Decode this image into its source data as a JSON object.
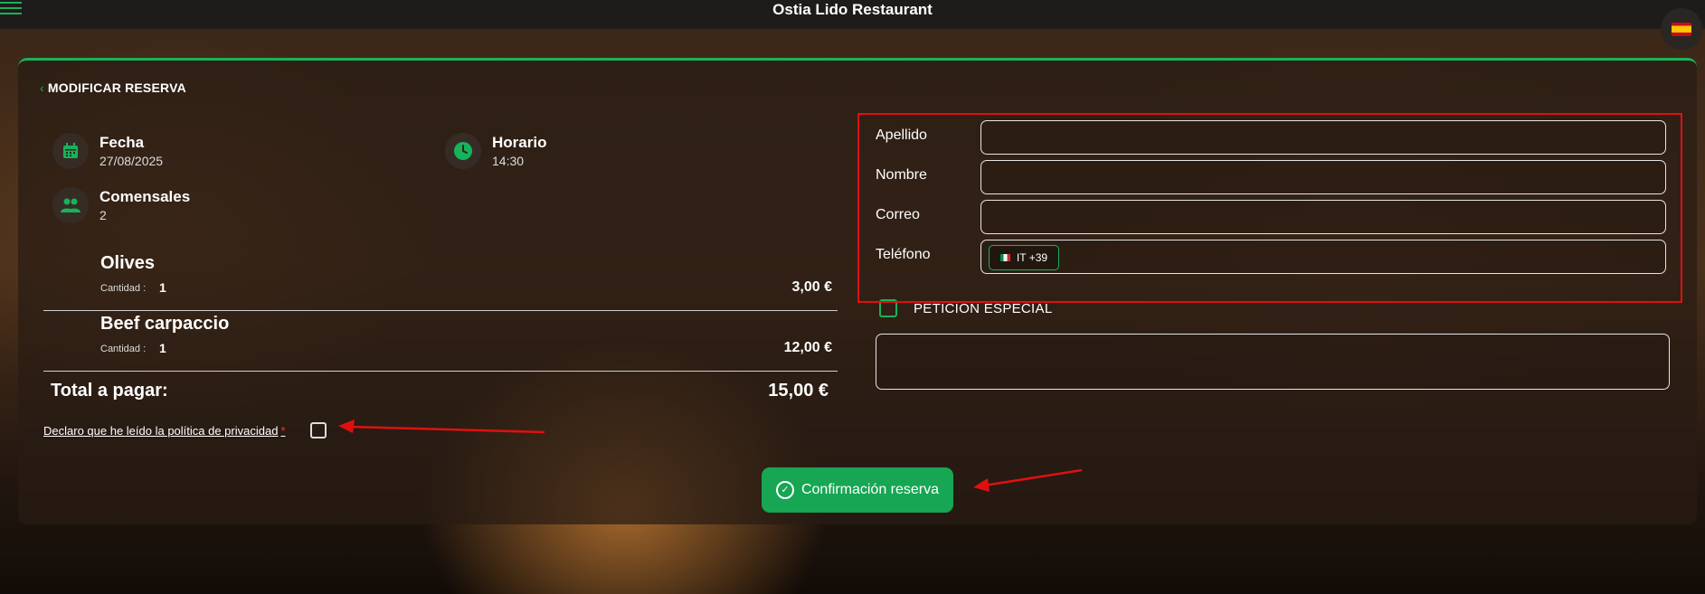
{
  "header": {
    "title": "Ostia Lido Restaurant",
    "menu_icon": "hamburger-menu-icon",
    "language_icon": "spain-flag-icon"
  },
  "card": {
    "back_label": "MODIFICAR RESERVA",
    "info": {
      "date": {
        "label": "Fecha",
        "value": "27/08/2025",
        "icon": "calendar-icon"
      },
      "time": {
        "label": "Horario",
        "value": "14:30",
        "icon": "clock-icon"
      },
      "guests": {
        "label": "Comensales",
        "value": "2",
        "icon": "people-icon"
      }
    },
    "items": [
      {
        "name": "Olives",
        "qty_label": "Cantidad :",
        "qty": "1",
        "price": "3,00 €"
      },
      {
        "name": "Beef carpaccio",
        "qty_label": "Cantidad :",
        "qty": "1",
        "price": "12,00 €"
      }
    ],
    "total": {
      "label": "Total a pagar:",
      "amount": "15,00 €"
    },
    "privacy": {
      "label": "Declaro que he leído la política de privacidad",
      "required_mark": "*"
    },
    "form": {
      "fields": [
        {
          "label": "Apellido",
          "value": ""
        },
        {
          "label": "Nombre",
          "value": ""
        },
        {
          "label": "Correo",
          "value": ""
        },
        {
          "label": "Teléfono",
          "value": ""
        }
      ],
      "phone_prefix": "IT +39",
      "special_request_label": "PETICIÓN ESPECIAL"
    },
    "confirm_label": "Confirmación reserva"
  },
  "colors": {
    "accent": "#18b25a",
    "annotation": "#e01010"
  }
}
